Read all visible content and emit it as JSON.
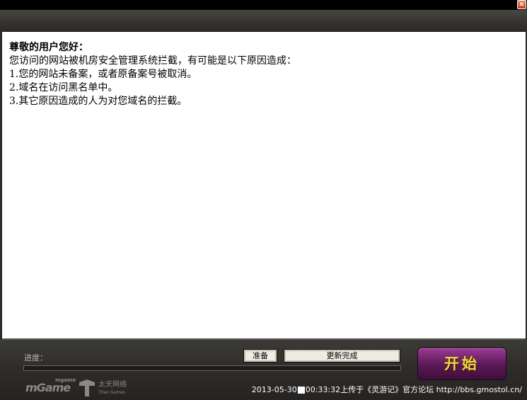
{
  "window": {
    "close_glyph": "×"
  },
  "content": {
    "greeting": "尊敬的用户您好：",
    "lines": [
      "您访问的网站被机房安全管理系统拦截，有可能是以下原因造成：",
      "1.您的网站未备案，或者原备案号被取消。",
      "2.域名在访问黑名单中。",
      "3.其它原因造成的人为对您域名的拦截。"
    ]
  },
  "bottom": {
    "progress_label": "进度：",
    "progress_percent": 0,
    "status_ready": "准备",
    "status_update": "更新完成",
    "start_button": "开始",
    "logo_left": "mGame",
    "logo_left_small": "mgame",
    "logo_right": "太天网络",
    "logo_right_sub": "Titan Games",
    "notice_date": "2013-05-30",
    "notice_time": "00:33:32",
    "notice_text": "上传于《灵游记》官方论坛 http://bbs.gmostol.cn/"
  }
}
